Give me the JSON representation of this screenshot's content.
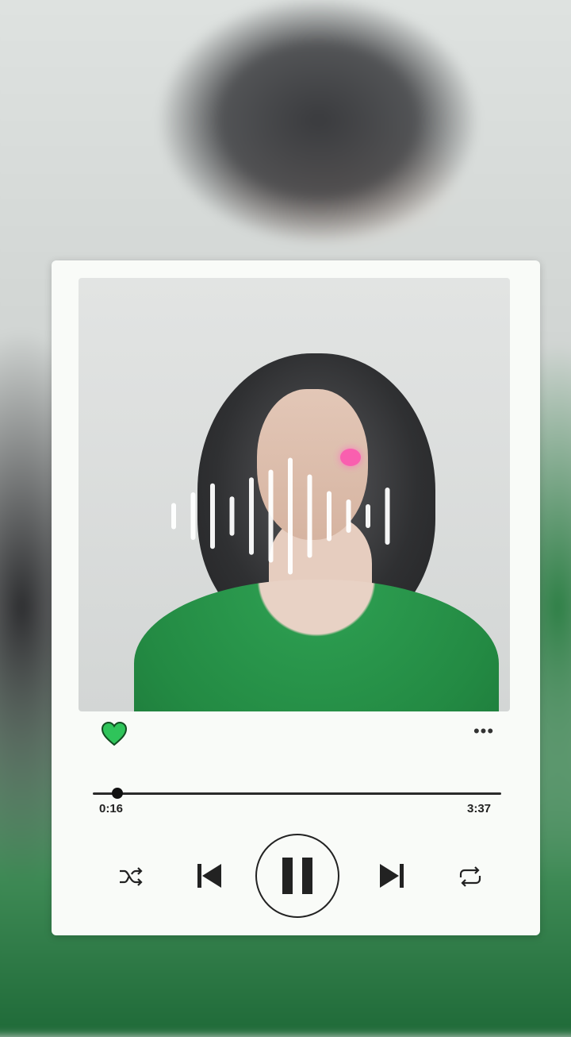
{
  "player": {
    "elapsed": "0:16",
    "duration": "3:37",
    "progress_fraction": 0.06,
    "liked": true,
    "more_icon": "more-horizontal-icon",
    "controls": [
      {
        "name": "shuffle-button",
        "icon": "shuffle-icon"
      },
      {
        "name": "previous-button",
        "icon": "skip-back-icon"
      },
      {
        "name": "pause-button",
        "icon": "pause-icon"
      },
      {
        "name": "next-button",
        "icon": "skip-forward-icon"
      },
      {
        "name": "repeat-button",
        "icon": "repeat-icon"
      }
    ]
  },
  "waveform": {
    "bars": [
      0.22,
      0.4,
      0.55,
      0.33,
      0.65,
      0.78,
      0.98,
      0.7,
      0.42,
      0.28,
      0.2,
      0.48
    ],
    "color": "#ffffff"
  },
  "colors": {
    "card": "#f9fbf8",
    "heart": "#2fc45a",
    "heart_outline": "#134d22",
    "control": "#222222",
    "accent_glint": "#ff4fb0"
  }
}
